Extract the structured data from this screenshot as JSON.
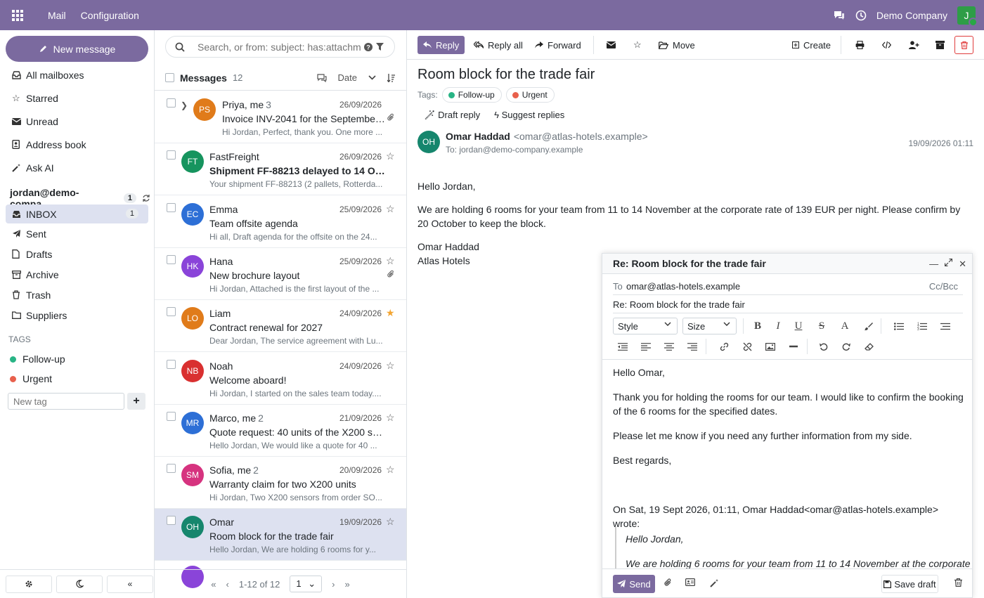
{
  "topbar": {
    "menu": [
      "Mail",
      "Configuration"
    ],
    "company": "Demo Company",
    "user_initial": "J"
  },
  "sidebar": {
    "new_message": "New message",
    "items": [
      {
        "label": "All mailboxes",
        "icon": "inbox-icon"
      },
      {
        "label": "Starred",
        "icon": "star-icon"
      },
      {
        "label": "Unread",
        "icon": "envelope-icon"
      },
      {
        "label": "Address book",
        "icon": "address-book-icon"
      },
      {
        "label": "Ask AI",
        "icon": "magic-wand-icon"
      }
    ],
    "account": {
      "email": "jordan@demo-compa...",
      "count": "1"
    },
    "folders": [
      {
        "label": "INBOX",
        "count": "1",
        "active": true
      },
      {
        "label": "Sent"
      },
      {
        "label": "Drafts"
      },
      {
        "label": "Archive"
      },
      {
        "label": "Trash"
      },
      {
        "label": "Suppliers"
      }
    ],
    "tags_heading": "TAGS",
    "tags": [
      {
        "label": "Follow-up",
        "color": "#28b485"
      },
      {
        "label": "Urgent",
        "color": "#e8604c"
      }
    ],
    "new_tag_placeholder": "New tag"
  },
  "list": {
    "search_placeholder": "Search, or from: subject: has:attachm",
    "header": {
      "title": "Messages",
      "count": "12",
      "sort": "Date"
    },
    "rows": [
      {
        "initials": "PS",
        "color": "#e07b1a",
        "from": "Priya, me",
        "thread": "3",
        "date": "26/09/2026",
        "subject": "Invoice INV-2041 for the September ...",
        "preview": "Hi Jordan, Perfect, thank you. One more ...",
        "attach": true
      },
      {
        "initials": "FT",
        "color": "#16945e",
        "from": "FastFreight",
        "date": "26/09/2026",
        "subject": "Shipment FF-88213 delayed to 14 Octo...",
        "preview": "Your shipment FF-88213 (2 pallets, Rotterda...",
        "unread": true
      },
      {
        "initials": "EC",
        "color": "#2d6fd6",
        "from": "Emma",
        "date": "25/09/2026",
        "subject": "Team offsite agenda",
        "preview": "Hi all, Draft agenda for the offsite on the 24..."
      },
      {
        "initials": "HK",
        "color": "#8a44d9",
        "from": "Hana",
        "date": "25/09/2026",
        "subject": "New brochure layout",
        "preview": "Hi Jordan, Attached is the first layout of the ...",
        "attach": true
      },
      {
        "initials": "LO",
        "color": "#e07b1a",
        "from": "Liam",
        "date": "24/09/2026",
        "subject": "Contract renewal for 2027",
        "preview": "Dear Jordan, The service agreement with Lu...",
        "starred": true
      },
      {
        "initials": "NB",
        "color": "#d93030",
        "from": "Noah",
        "date": "24/09/2026",
        "subject": "Welcome aboard!",
        "preview": "Hi Jordan, I started on the sales team today...."
      },
      {
        "initials": "MR",
        "color": "#2d6fd6",
        "from": "Marco, me",
        "thread": "2",
        "date": "21/09/2026",
        "subject": "Quote request: 40 units of the X200 sens...",
        "preview": "Hello Jordan, We would like a quote for 40 ..."
      },
      {
        "initials": "SM",
        "color": "#d6337f",
        "from": "Sofia, me",
        "thread": "2",
        "date": "20/09/2026",
        "subject": "Warranty claim for two X200 units",
        "preview": "Hi Jordan, Two X200 sensors from order SO..."
      },
      {
        "initials": "OH",
        "color": "#16866d",
        "from": "Omar",
        "date": "19/09/2026",
        "subject": "Room block for the trade fair",
        "preview": "Hello Jordan, We are holding 6 rooms for y...",
        "selected": true
      }
    ],
    "pager": {
      "range": "1-12 of 12",
      "page": "1"
    }
  },
  "reader": {
    "toolbar": {
      "reply": "Reply",
      "reply_all": "Reply all",
      "forward": "Forward",
      "move": "Move",
      "create": "Create"
    },
    "title": "Room block for the trade fair",
    "tags_label": "Tags:",
    "tags": [
      {
        "label": "Follow-up",
        "color": "#28b485"
      },
      {
        "label": "Urgent",
        "color": "#e8604c"
      }
    ],
    "ai": {
      "draft": "Draft reply",
      "suggest": "Suggest replies"
    },
    "sender": {
      "initials": "OH",
      "name": "Omar Haddad",
      "email": "<omar@atlas-hotels.example>",
      "to": "To: jordan@demo-company.example",
      "date": "19/09/2026 01:11"
    },
    "body": [
      "Hello Jordan,",
      "We are holding 6 rooms for your team from 11 to 14 November at the corporate rate of 139 EUR per night. Please confirm by 20 October to keep the block.",
      "Omar Haddad",
      "Atlas Hotels"
    ]
  },
  "composer": {
    "title": "Re: Room block for the trade fair",
    "to_label": "To",
    "to": "omar@atlas-hotels.example",
    "ccbcc": "Cc/Bcc",
    "subject": "Re: Room block for the trade fair",
    "style_label": "Style",
    "size_label": "Size",
    "body": [
      "Hello Omar,",
      "Thank you for holding the rooms for our team. I would like to confirm the booking of the 6 rooms for the specified dates.",
      "Please let me know if you need any further information from my side.",
      "Best regards,"
    ],
    "quote_header": "On Sat, 19 Sept 2026, 01:11, Omar Haddad<omar@atlas-hotels.example> wrote:",
    "quote": [
      "Hello Jordan,",
      "We are holding 6 rooms for your team from 11 to 14 November at the corporate"
    ],
    "send": "Send",
    "save_draft": "Save draft"
  }
}
